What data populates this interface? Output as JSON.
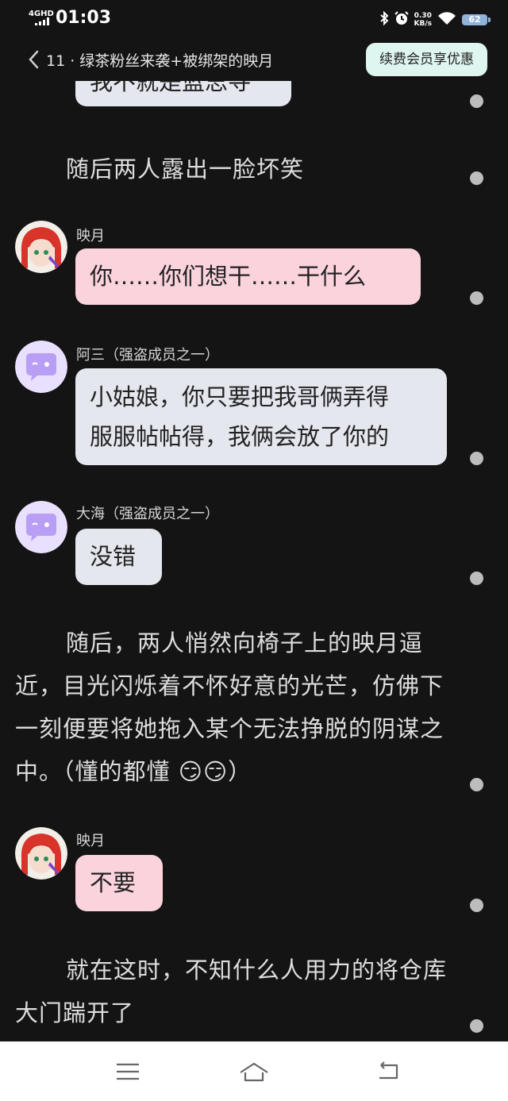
{
  "status_bar": {
    "network": "4GHD",
    "time": "01:03",
    "speed_value": "0.30",
    "speed_unit": "KB/s",
    "battery": "62"
  },
  "header": {
    "title": "11 · 绿茶粉丝来袭+被绑架的映月",
    "vip_button": "续费会员享优惠"
  },
  "story": {
    "top_partial_bubble": "我不就是蓝思寻",
    "narration_1": "随后两人露出一脸坏笑",
    "msg_1": {
      "name": "映月",
      "lines": [
        "你……你们想干……干什么"
      ]
    },
    "msg_2": {
      "name": "阿三（强盗成员之一）",
      "lines": [
        "小姑娘，你只要把我哥俩弄得",
        "服服帖帖得，我俩会放了你的"
      ]
    },
    "msg_3": {
      "name": "大海（强盗成员之一）",
      "lines": [
        "没错"
      ]
    },
    "narration_2": "随后，两人悄然向椅子上的映月逼近，目光闪烁着不怀好意的光芒，仿佛下一刻便要将她拖入某个无法挣脱的阴谋之中。（懂的都懂 😏😏）",
    "msg_4": {
      "name": "映月",
      "lines": [
        "不要"
      ]
    },
    "narration_3": "就在这时，不知什么人用力的将仓库大门踹开了"
  },
  "nav": {
    "icons": [
      "menu-icon",
      "home-icon",
      "back-icon"
    ]
  },
  "colors": {
    "background": "#141414",
    "bubble_pink": "#fbd3dc",
    "bubble_gray": "#e4e7ee",
    "vip_bg": "#dff5ef"
  }
}
